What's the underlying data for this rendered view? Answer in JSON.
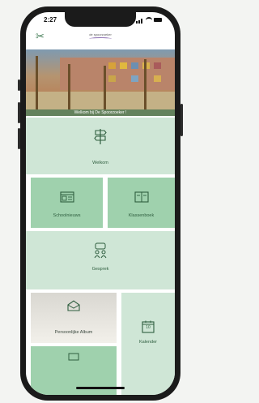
{
  "status": {
    "time": "2:27"
  },
  "header": {
    "logo_text": "de spoorzoeker"
  },
  "banner": {
    "caption": "Welkom bij De Spoorzoeker !"
  },
  "tiles": [
    {
      "label": "Welkom",
      "icon": "signpost-icon"
    },
    {
      "label": "Schoolnieuws",
      "icon": "newspaper-icon"
    },
    {
      "label": "Klassenboek",
      "icon": "open-book-icon"
    },
    {
      "label": "Gesprek",
      "icon": "meeting-icon"
    },
    {
      "label": "Persoonlijke Album",
      "icon": "photo-album-icon"
    },
    {
      "label": "Kalender",
      "icon": "calendar-icon",
      "day": "10"
    }
  ],
  "colors": {
    "tile": "#cfe6d6",
    "tile_dark": "#9fd1ad",
    "accent": "#3f7a52"
  }
}
